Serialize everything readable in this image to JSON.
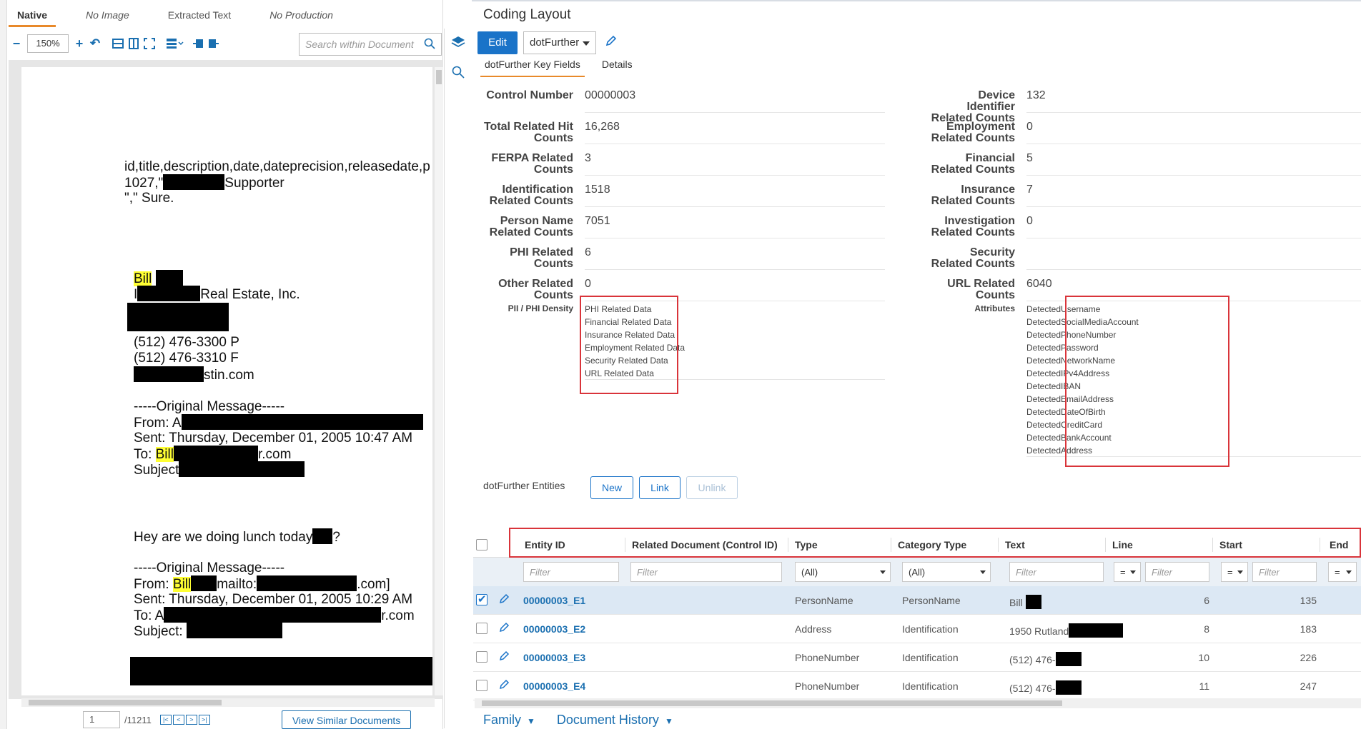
{
  "viewer": {
    "tabs": [
      "Native",
      "No Image",
      "Extracted Text",
      "No Production"
    ],
    "zoom": "150%",
    "search_placeholder": "Search within Document",
    "page_number": "1",
    "page_total": "/11211",
    "similar_button": "View Similar Documents",
    "document_lines": {
      "l1": "id,title,description,date,dateprecision,releasedate,p",
      "l2a": "1027,\"",
      "l2b": "Supporter",
      "l3": "\",\"   Sure.",
      "l4": "Bill",
      "l5a": "I",
      "l5b": "Real Estate, Inc.",
      "l6": "(512) 476-3300 P",
      "l7": "(512) 476-3310 F",
      "l8": "stin.com",
      "l9": "-----Original Message-----",
      "l10": "From: A",
      "l11": "Sent: Thursday, December 01, 2005  10:47 AM",
      "l12a": "To: ",
      "l12b": "Bill",
      "l12c": "r.com",
      "l13": "Subject",
      "l14a": "Hey are we doing lunch today",
      "l14b": "?",
      "l15": "-----Original Message-----",
      "l16a": "From: ",
      "l16b": "Bill",
      "l16c": "mailto:",
      "l16d": ".com]",
      "l17": "Sent: Thursday, December 01, 2005  10:29 AM",
      "l18a": "To: A",
      "l18b": "r.com",
      "l19": "Subject: "
    }
  },
  "coding": {
    "title": "Coding Layout",
    "edit_label": "Edit",
    "layout_name": "dotFurther",
    "subtabs": [
      "dotFurther Key Fields",
      "Details"
    ],
    "fields_left": [
      {
        "label": "Control Number",
        "value": "00000003"
      },
      {
        "label": "Total Related Hit Counts",
        "value": "16,268"
      },
      {
        "label": "FERPA Related Counts",
        "value": "3"
      },
      {
        "label": "Identification Related Counts",
        "value": "1518"
      },
      {
        "label": "Person Name Related Counts",
        "value": "7051"
      },
      {
        "label": "PHI Related Counts",
        "value": "6"
      },
      {
        "label": "Other Related Counts",
        "value": "0"
      }
    ],
    "fields_right": [
      {
        "label": "Device Identifier Related Counts",
        "value": "132"
      },
      {
        "label": "Employment Related Counts",
        "value": "0"
      },
      {
        "label": "Financial Related Counts",
        "value": "5"
      },
      {
        "label": "Insurance Related Counts",
        "value": "7"
      },
      {
        "label": "Investigation Related Counts",
        "value": "0"
      },
      {
        "label": "Security Related Counts",
        "value": ""
      },
      {
        "label": "URL Related Counts",
        "value": "6040"
      }
    ],
    "density_label": "PII / PHI Density",
    "density": [
      "PHI Related Data",
      "Financial Related Data",
      "Insurance Related Data",
      "Employment Related Data",
      "Security Related Data",
      "URL Related Data"
    ],
    "attributes_label": "Attributes",
    "attributes": [
      "DetectedUsername",
      "DetectedSocialMediaAccount",
      "DetectedPhoneNumber",
      "DetectedPassword",
      "DetectedNetworkName",
      "DetectedIPv4Address",
      "DetectedIBAN",
      "DetectedEmailAddress",
      "DetectedDateOfBirth",
      "DetectedCreditCard",
      "DetectedBankAccount",
      "DetectedAddress"
    ],
    "entities_label": "dotFurther Entities",
    "entity_buttons": [
      "New",
      "Link",
      "Unlink"
    ]
  },
  "grid": {
    "headers": [
      "Entity ID",
      "Related Document (Control ID)",
      "Type",
      "Category Type",
      "Text",
      "Line",
      "Start",
      "End"
    ],
    "filter_placeholder": "Filter",
    "all_option": "(All)",
    "eq_option": "=",
    "rows": [
      {
        "id": "00000003_E1",
        "type": "PersonName",
        "category": "PersonName",
        "text": "Bill",
        "line": "6",
        "start": "135",
        "checked": true
      },
      {
        "id": "00000003_E2",
        "type": "Address",
        "category": "Identification",
        "text": "1950 Rutland",
        "line": "8",
        "start": "183",
        "checked": false
      },
      {
        "id": "00000003_E3",
        "type": "PhoneNumber",
        "category": "Identification",
        "text": "(512) 476-",
        "line": "10",
        "start": "226",
        "checked": false
      },
      {
        "id": "00000003_E4",
        "type": "PhoneNumber",
        "category": "Identification",
        "text": "(512) 476-",
        "line": "11",
        "start": "247",
        "checked": false
      }
    ]
  },
  "bottom_tabs": [
    "Family",
    "Document History"
  ],
  "colors": {
    "accent": "#1a73c8",
    "tab_underline": "#e8892a",
    "highlight_box": "#d9343a",
    "redaction": "#000000",
    "text_highlight": "#ffff33"
  }
}
